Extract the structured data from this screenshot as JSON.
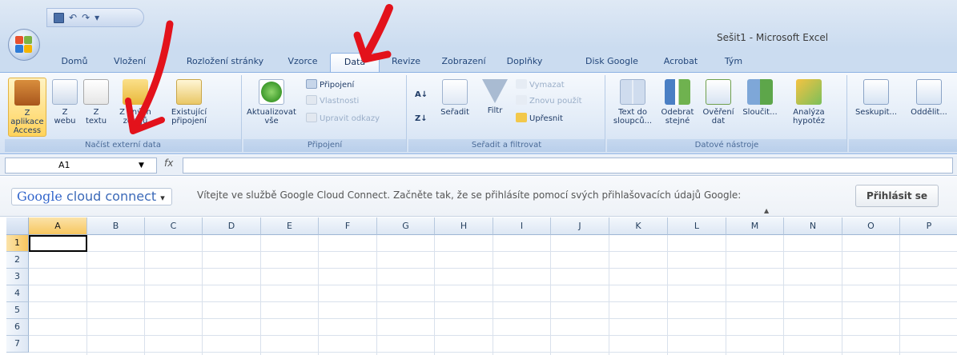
{
  "window": {
    "title": "Sešit1 - Microsoft Excel"
  },
  "qat": {
    "icons": [
      "save-icon",
      "undo-icon",
      "redo-icon",
      "customize-qat-icon"
    ],
    "undo_glyph": "↶",
    "redo_glyph": "↷",
    "more_glyph": "▾"
  },
  "tabs": [
    {
      "label": "Domů"
    },
    {
      "label": "Vložení"
    },
    {
      "label": "Rozložení stránky"
    },
    {
      "label": "Vzorce"
    },
    {
      "label": "Data",
      "active": true
    },
    {
      "label": "Revize"
    },
    {
      "label": "Zobrazení"
    },
    {
      "label": "Doplňky"
    },
    {
      "label": "Disk Google"
    },
    {
      "label": "Acrobat"
    },
    {
      "label": "Tým"
    }
  ],
  "ribbon": {
    "groups": {
      "external": "Načíst externí data",
      "connections": "Připojení",
      "sort": "Seřadit a filtrovat",
      "tools": "Datové nástroje"
    },
    "external": {
      "access": "Z aplikace Access",
      "web": "Z webu",
      "text": "Z textu",
      "other": "Z jiných zdrojů",
      "existing": "Existující připojení"
    },
    "connections": {
      "refresh": "Aktualizovat vše",
      "connections": "Připojení",
      "properties": "Vlastnosti",
      "edit_links": "Upravit odkazy"
    },
    "sort": {
      "az": "A↓",
      "za": "Z↓",
      "sort": "Seřadit",
      "filter": "Filtr",
      "clear": "Vymazat",
      "reapply": "Znovu použít",
      "advanced": "Upřesnit"
    },
    "tools": {
      "text_to_columns": "Text do sloupců...",
      "remove_duplicates": "Odebrat stejné",
      "validation": "Ověření dat",
      "consolidate": "Sloučit...",
      "whatif": "Analýza hypotéz"
    },
    "outline": {
      "group": "Seskupit...",
      "ungroup": "Oddělit..."
    }
  },
  "formula_bar": {
    "name_box": "A1",
    "fx": "fx",
    "formula": ""
  },
  "gcc": {
    "logo_google": "Google",
    "logo_rest": "cloud connect",
    "dropdown": "▾",
    "message": "Vítejte ve službě Google Cloud Connect. Začněte tak, že se přihlásíte pomocí svých přihlašovacích údajů Google:",
    "signin": "Přihlásit se"
  },
  "grid": {
    "columns": [
      "A",
      "B",
      "C",
      "D",
      "E",
      "F",
      "G",
      "H",
      "I",
      "J",
      "K",
      "L",
      "M",
      "N",
      "O",
      "P"
    ],
    "rows": [
      "1",
      "2",
      "3",
      "4",
      "5",
      "6",
      "7"
    ],
    "selected_cell": "A1"
  },
  "colors": {
    "annotation": "#e3121b",
    "accent": "#8db2e3"
  }
}
